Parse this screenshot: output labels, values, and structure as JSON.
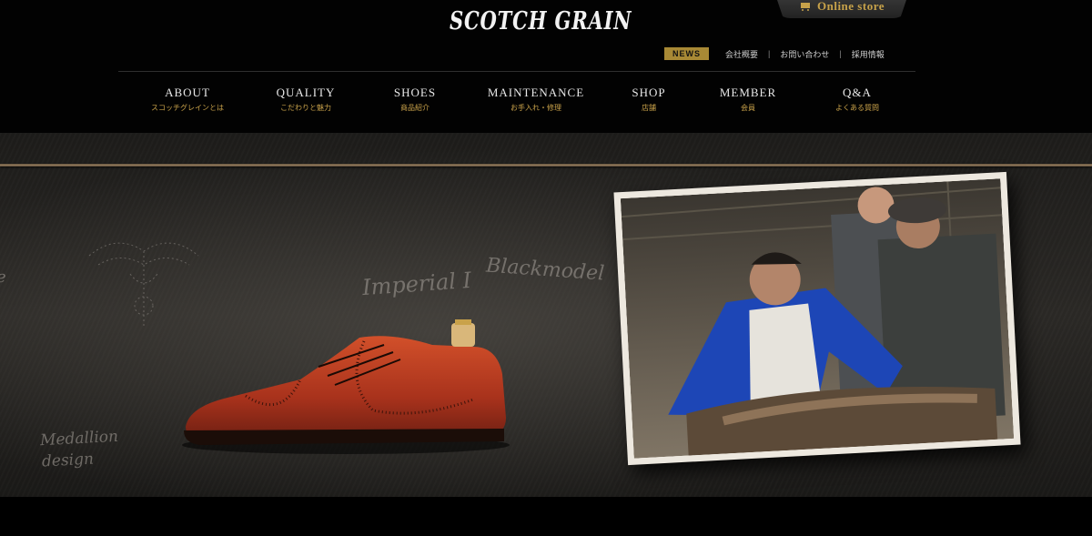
{
  "header": {
    "logo": "SCOTCH GRAIN",
    "online_store": "Online store",
    "utility": {
      "news": "NEWS",
      "links": [
        "会社概要",
        "お問い合わせ",
        "採用情報"
      ],
      "separator": "|"
    }
  },
  "nav": [
    {
      "en": "ABOUT",
      "jp": "スコッチグレインとは"
    },
    {
      "en": "QUALITY",
      "jp": "こだわりと魅力"
    },
    {
      "en": "SHOES",
      "jp": "商品紹介"
    },
    {
      "en": "MAINTENANCE",
      "jp": "お手入れ・修理"
    },
    {
      "en": "SHOP",
      "jp": "店舗"
    },
    {
      "en": "MEMBER",
      "jp": "会員"
    },
    {
      "en": "Q&A",
      "jp": "よくある質問"
    }
  ],
  "hero": {
    "sketch_labels": {
      "model": "Imperial I",
      "blackmodel": "Blackmodel",
      "medallion": "Medallion",
      "design": "design",
      "edge": "e"
    }
  },
  "colors": {
    "gold": "#c9a24a",
    "news_bg": "#a88935",
    "shoe": "#b53a20"
  }
}
